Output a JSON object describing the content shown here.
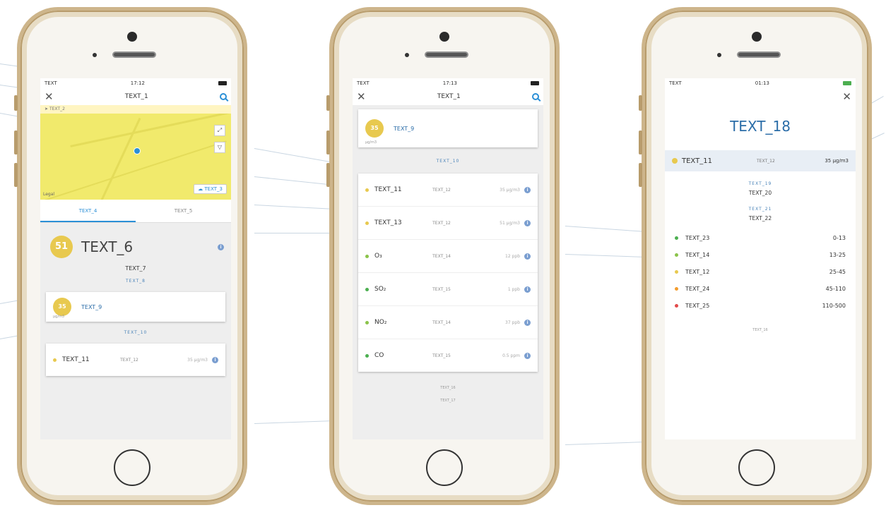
{
  "phones": [
    {
      "status": {
        "carrier": "TEXT",
        "time": "17:12"
      },
      "nav": {
        "title": "TEXT_1"
      },
      "location_bar": "TEXT_2",
      "map": {
        "legal": "Legal",
        "weather": "TEXT_3"
      },
      "tabs": [
        "TEXT_4",
        "TEXT_5"
      ],
      "aqi": {
        "value": "51",
        "level": "TEXT_6",
        "description": "TEXT_7",
        "link": "TEXT_8"
      },
      "main_pollutant": {
        "value": "35",
        "unit": "μg/m3",
        "text": "TEXT_9"
      },
      "detail_link": "TEXT_10",
      "rows": [
        {
          "name": "TEXT_11",
          "level": "TEXT_12",
          "value": "35 μg/m3",
          "color": "#e8c94f"
        }
      ]
    },
    {
      "status": {
        "carrier": "TEXT",
        "time": "17:13"
      },
      "nav": {
        "title": "TEXT_1"
      },
      "main_pollutant": {
        "value": "35",
        "unit": "μg/m3",
        "text": "TEXT_9"
      },
      "detail_link": "TEXT_10",
      "rows": [
        {
          "name": "TEXT_11",
          "level": "TEXT_12",
          "value": "35 μg/m3",
          "color": "#e8c94f"
        },
        {
          "name": "TEXT_13",
          "level": "TEXT_12",
          "value": "51 μg/m3",
          "color": "#e8c94f"
        },
        {
          "name": "O₃",
          "level": "TEXT_14",
          "value": "12 ppb",
          "color": "#8bc34a"
        },
        {
          "name": "SO₂",
          "level": "TEXT_15",
          "value": "1 ppb",
          "color": "#4caf50"
        },
        {
          "name": "NO₂",
          "level": "TEXT_14",
          "value": "37 ppb",
          "color": "#8bc34a"
        },
        {
          "name": "CO",
          "level": "TEXT_15",
          "value": "0.5 ppm",
          "color": "#4caf50"
        }
      ],
      "source": "TEXT_16",
      "footnote": "TEXT_17"
    },
    {
      "status": {
        "carrier": "TEXT",
        "time": "01:13"
      },
      "title": "TEXT_18",
      "selected": {
        "name": "TEXT_11",
        "level": "TEXT_12",
        "value": "35 μg/m3",
        "color": "#e8c94f"
      },
      "effects_heading": "TEXT_19",
      "effects_text": "TEXT_20",
      "sources_heading": "TEXT_21",
      "sources_text": "TEXT_22",
      "levels": [
        {
          "name": "TEXT_23",
          "range": "0-13",
          "color": "#4caf50"
        },
        {
          "name": "TEXT_14",
          "range": "13-25",
          "color": "#8bc34a"
        },
        {
          "name": "TEXT_12",
          "range": "25-45",
          "color": "#e8c94f"
        },
        {
          "name": "TEXT_24",
          "range": "45-110",
          "color": "#f39c2d"
        },
        {
          "name": "TEXT_25",
          "range": "110-500",
          "color": "#e24b4b"
        }
      ],
      "source": "TEXT_16"
    }
  ]
}
